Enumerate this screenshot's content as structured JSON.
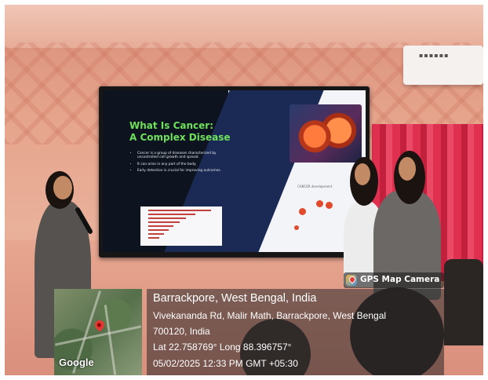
{
  "photo": {
    "slide": {
      "title_line1": "What Is Cancer:",
      "title_line2": "A Complex Disease",
      "bullets": [
        "Cancer is a group of diseases characterized by uncontrolled cell growth and spread.",
        "It can arise in any part of the body.",
        "Early detection is crucial for improving outcomes."
      ],
      "diagram_label": "CANCER development"
    }
  },
  "gps": {
    "app_name": "GPS Map Camera",
    "map_brand": "Google",
    "location_title": "Barrackpore, West Bengal, India",
    "address_line1": "Vivekananda Rd, Malir Math, Barrackpore, West Bengal",
    "address_line2": "700120, India",
    "coordinates": "Lat 22.758769° Long 88.396757°",
    "datetime": "05/02/2025 12:33 PM GMT +05:30"
  }
}
